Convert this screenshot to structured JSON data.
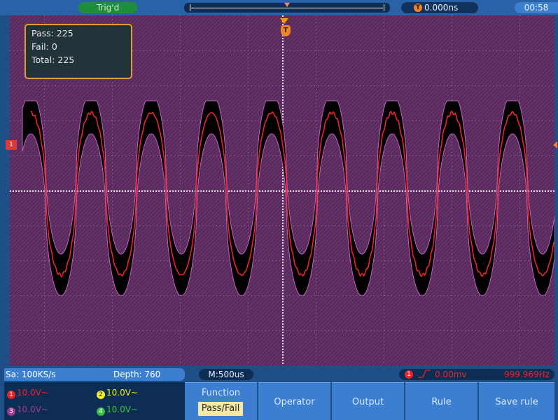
{
  "top_bar": {
    "trigger_status": "Trig'd",
    "trigger_delay": "0.000ns",
    "trigger_icon": "T",
    "clock": "00:58"
  },
  "pass_fail_box": {
    "pass": "Pass: 225",
    "fail": "Fail: 0",
    "total": "Total: 225"
  },
  "markers": {
    "channel1": "1",
    "trigger": "T"
  },
  "status_bar": {
    "sample_rate": "Sa: 100KS/s",
    "depth": "Depth: 760",
    "timebase": "M:500us",
    "trigger_channel": "1",
    "trigger_edge_icon": "rising-edge-icon",
    "trigger_level": "0.00mv",
    "frequency": "999.969Hz"
  },
  "channels": [
    {
      "num": "1",
      "label": "10.0V~",
      "color": "#e8262a"
    },
    {
      "num": "2",
      "label": "10.0V~",
      "color": "#f0f020"
    },
    {
      "num": "3",
      "label": "10.0V~",
      "color": "#a23b8e"
    },
    {
      "num": "4",
      "label": "10.0V~",
      "color": "#39c23f"
    }
  ],
  "menu": {
    "function_title": "Function",
    "function_value": "Pass/Fail",
    "operator": "Operator",
    "output": "Output",
    "rule": "Rule",
    "save_rule": "Save rule"
  },
  "colors": {
    "screen_bg": "#5a2a5e",
    "trace": "#e8262a",
    "mask": "#000000",
    "button": "#3c7fd1",
    "accent": "#f08424"
  }
}
